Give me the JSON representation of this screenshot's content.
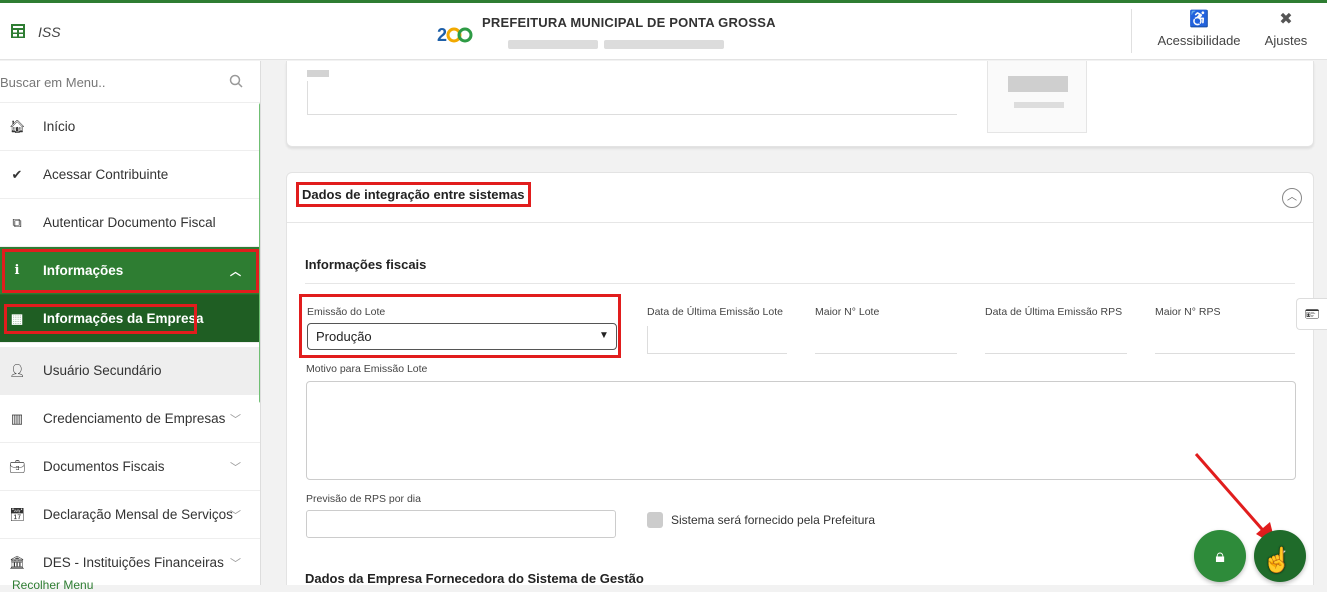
{
  "header": {
    "app_name": "ISS",
    "gov_title": "PREFEITURA MUNICIPAL DE PONTA GROSSA",
    "accessibility_label": "Acessibilidade",
    "settings_label": "Ajustes"
  },
  "sidebar": {
    "search_placeholder": "Buscar em Menu..",
    "items": [
      {
        "label": "Início",
        "icon": "home-icon"
      },
      {
        "label": "Acessar Contribuinte",
        "icon": "check-icon"
      },
      {
        "label": "Autenticar Documento Fiscal",
        "icon": "copy-icon"
      },
      {
        "label": "Informações",
        "icon": "info-icon"
      },
      {
        "label": "Informações da Empresa",
        "icon": "building-icon"
      },
      {
        "label": "Usuário Secundário",
        "icon": "user-icon"
      },
      {
        "label": "Credenciamento de Empresas",
        "icon": "building-icon"
      },
      {
        "label": "Documentos Fiscais",
        "icon": "briefcase-icon"
      },
      {
        "label": "Declaração Mensal de Serviços",
        "icon": "calendar-icon"
      },
      {
        "label": "DES - Instituições Financeiras",
        "icon": "bank-icon"
      }
    ],
    "collapse_label": "Recolher Menu"
  },
  "section": {
    "title": "Dados de integração entre sistemas",
    "subtitle": "Informações fiscais",
    "fields": {
      "emissao_lote_label": "Emissão do Lote",
      "emissao_lote_value": "Produção",
      "data_ultima_lote_label": "Data de Última Emissão Lote",
      "maior_lote_label": "Maior N° Lote",
      "data_ultima_rps_label": "Data de Última Emissão RPS",
      "maior_rps_label": "Maior N° RPS",
      "motivo_label": "Motivo para Emissão Lote",
      "previsao_label": "Previsão de RPS por dia",
      "sistema_checkbox_label": "Sistema será fornecido pela Prefeitura"
    },
    "fornecedora_title": "Dados da Empresa Fornecedora do Sistema de Gestão"
  },
  "colors": {
    "brand_green": "#2e7d32",
    "highlight_red": "#e11d1d"
  }
}
